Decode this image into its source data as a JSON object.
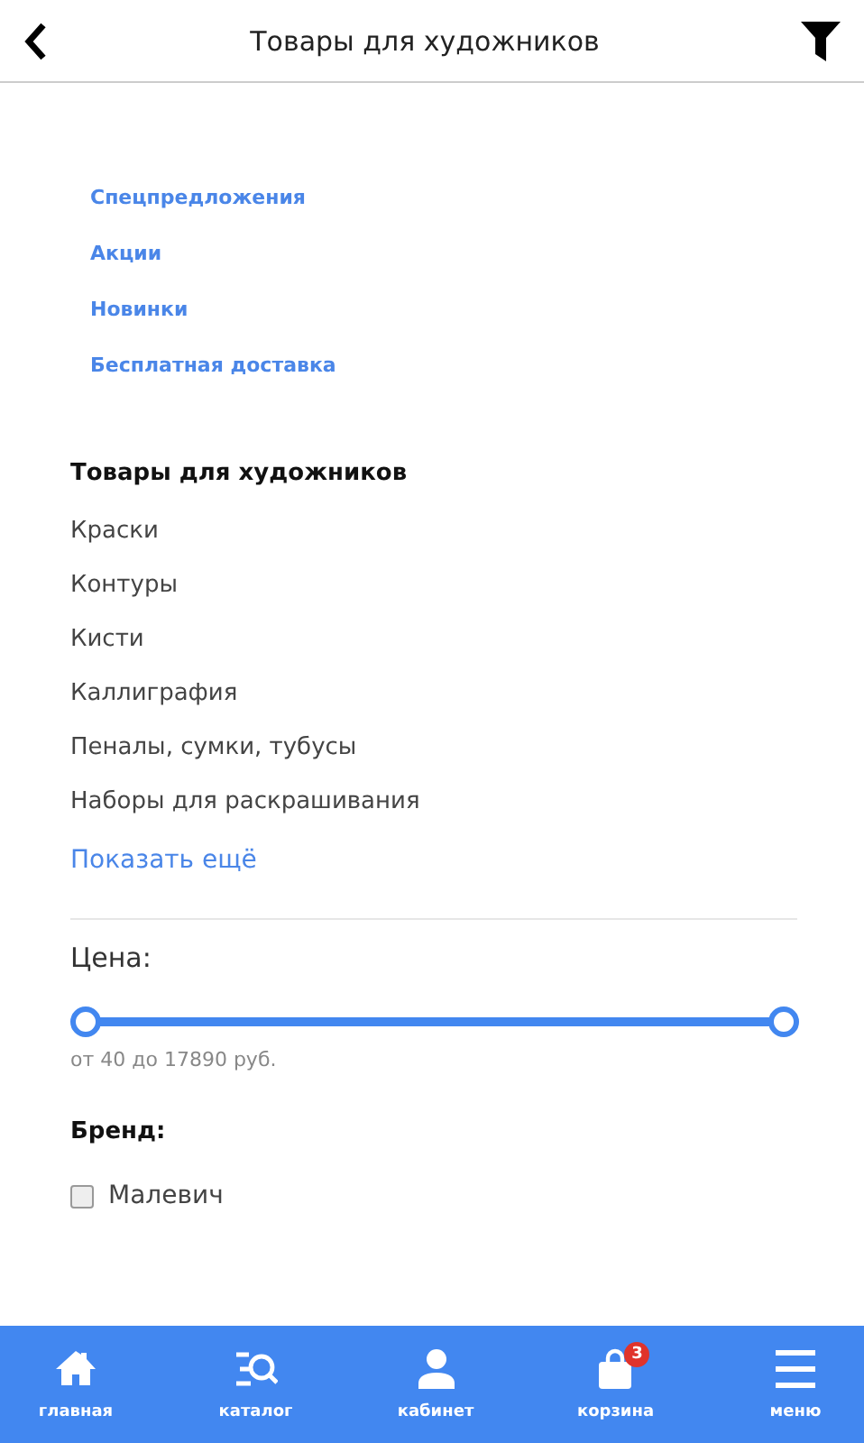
{
  "header": {
    "title": "Товары для художников"
  },
  "quick_links": [
    "Спецпредложения",
    "Акции",
    "Новинки",
    "Бесплатная доставка"
  ],
  "category": {
    "title": "Товары для художников",
    "items": [
      "Краски",
      "Контуры",
      "Кисти",
      "Каллиграфия",
      "Пеналы, сумки, тубусы",
      "Наборы для раскрашивания"
    ],
    "more": "Показать ещё"
  },
  "price": {
    "label": "Цена:",
    "reading": "от 40 до 17890 руб."
  },
  "brand": {
    "label": "Бренд:",
    "options": [
      {
        "label": "Малевич",
        "checked": false
      }
    ]
  },
  "nav": [
    {
      "kind": "home",
      "label": "главная"
    },
    {
      "kind": "catalog",
      "label": "каталог"
    },
    {
      "kind": "user",
      "label": "кабинет"
    },
    {
      "kind": "cart",
      "label": "корзина",
      "badge": "3"
    },
    {
      "kind": "menu",
      "label": "меню"
    }
  ]
}
